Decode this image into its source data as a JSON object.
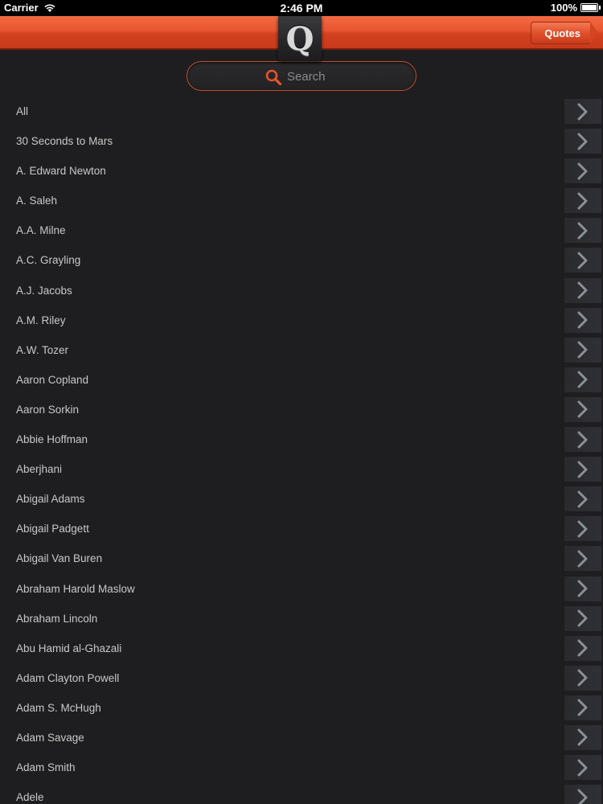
{
  "status_bar": {
    "carrier": "Carrier",
    "time": "2:46 PM",
    "battery": "100%"
  },
  "header": {
    "logo_letter": "Q",
    "quotes_button_label": "Quotes",
    "accent_color": "#e8532e"
  },
  "search": {
    "placeholder": "Search",
    "value": ""
  },
  "authors": [
    "All",
    "30 Seconds to Mars",
    "A. Edward Newton",
    "A. Saleh",
    "A.A. Milne",
    "A.C. Grayling",
    "A.J. Jacobs",
    "A.M. Riley",
    "A.W. Tozer",
    "Aaron Copland",
    "Aaron Sorkin",
    "Abbie Hoffman",
    "Aberjhani",
    "Abigail Adams",
    "Abigail Padgett",
    "Abigail Van Buren",
    "Abraham Harold Maslow",
    "Abraham Lincoln",
    "Abu Hamid al-Ghazali",
    "Adam Clayton Powell",
    "Adam S. McHugh",
    "Adam Savage",
    "Adam Smith",
    "Adele"
  ],
  "icons": {
    "wifi": "wifi-icon",
    "battery": "battery-icon",
    "search": "search-icon",
    "disclosure": "chevron-right-icon"
  }
}
